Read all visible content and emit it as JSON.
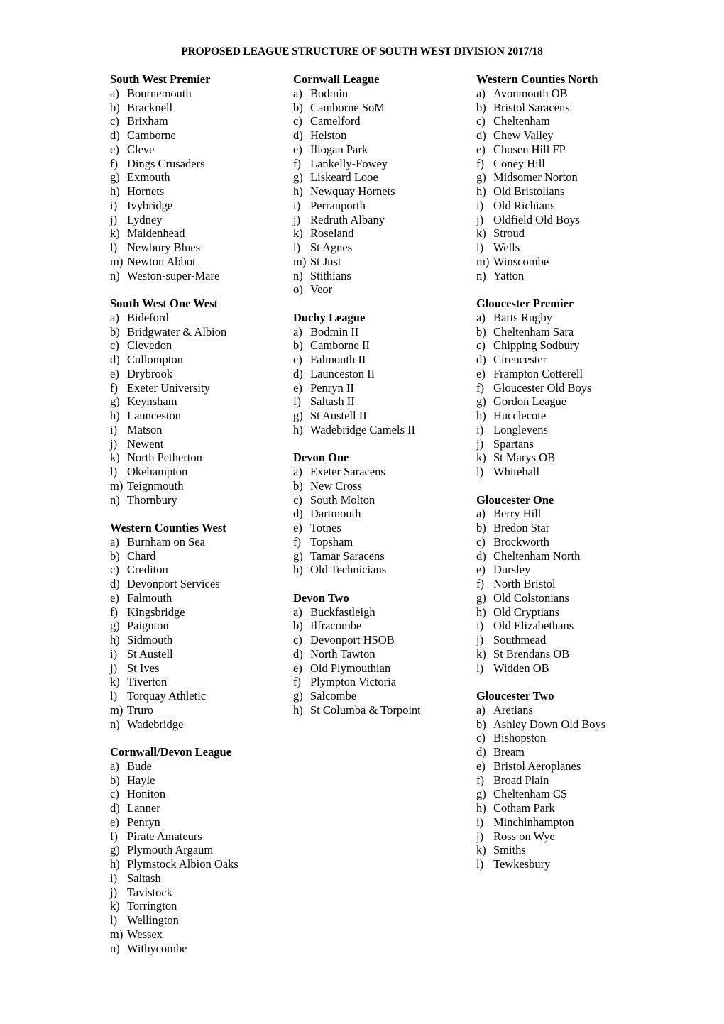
{
  "title": "PROPOSED LEAGUE STRUCTURE OF SOUTH WEST DIVISION 2017/18",
  "columns": [
    {
      "sections": [
        {
          "heading": "South West Premier",
          "teams": [
            {
              "letter": "a)",
              "name": "Bournemouth"
            },
            {
              "letter": "b)",
              "name": "Bracknell"
            },
            {
              "letter": "c)",
              "name": "Brixham"
            },
            {
              "letter": "d)",
              "name": "Camborne"
            },
            {
              "letter": "e)",
              "name": "Cleve"
            },
            {
              "letter": "f)",
              "name": "Dings Crusaders"
            },
            {
              "letter": "g)",
              "name": "Exmouth"
            },
            {
              "letter": "h)",
              "name": "Hornets"
            },
            {
              "letter": "i)",
              "name": "Ivybridge"
            },
            {
              "letter": "j)",
              "name": "Lydney"
            },
            {
              "letter": "k)",
              "name": "Maidenhead"
            },
            {
              "letter": "l)",
              "name": "Newbury Blues"
            },
            {
              "letter": "m)",
              "name": "Newton Abbot"
            },
            {
              "letter": "n)",
              "name": "Weston-super-Mare"
            }
          ]
        },
        {
          "heading": "South West One West",
          "teams": [
            {
              "letter": "a)",
              "name": "Bideford"
            },
            {
              "letter": "b)",
              "name": "Bridgwater & Albion"
            },
            {
              "letter": "c)",
              "name": "Clevedon"
            },
            {
              "letter": "d)",
              "name": "Cullompton"
            },
            {
              "letter": "e)",
              "name": "Drybrook"
            },
            {
              "letter": "f)",
              "name": "Exeter University"
            },
            {
              "letter": "g)",
              "name": "Keynsham"
            },
            {
              "letter": "h)",
              "name": "Launceston"
            },
            {
              "letter": "i)",
              "name": "Matson"
            },
            {
              "letter": "j)",
              "name": "Newent"
            },
            {
              "letter": "k)",
              "name": "North Petherton"
            },
            {
              "letter": "l)",
              "name": "Okehampton"
            },
            {
              "letter": "m)",
              "name": "Teignmouth"
            },
            {
              "letter": "n)",
              "name": "Thornbury"
            }
          ]
        },
        {
          "heading": "Western Counties West",
          "teams": [
            {
              "letter": "a)",
              "name": "Burnham on Sea"
            },
            {
              "letter": "b)",
              "name": "Chard"
            },
            {
              "letter": "c)",
              "name": "Crediton"
            },
            {
              "letter": "d)",
              "name": "Devonport Services"
            },
            {
              "letter": "e)",
              "name": "Falmouth"
            },
            {
              "letter": "f)",
              "name": "Kingsbridge"
            },
            {
              "letter": "g)",
              "name": "Paignton"
            },
            {
              "letter": "h)",
              "name": "Sidmouth"
            },
            {
              "letter": "i)",
              "name": "St Austell"
            },
            {
              "letter": "j)",
              "name": "St Ives"
            },
            {
              "letter": "k)",
              "name": "Tiverton"
            },
            {
              "letter": "l)",
              "name": "Torquay Athletic"
            },
            {
              "letter": "m)",
              "name": "Truro"
            },
            {
              "letter": "n)",
              "name": "Wadebridge"
            }
          ]
        },
        {
          "heading": "Cornwall/Devon League",
          "teams": [
            {
              "letter": "a)",
              "name": "Bude"
            },
            {
              "letter": "b)",
              "name": "Hayle"
            },
            {
              "letter": "c)",
              "name": "Honiton"
            },
            {
              "letter": "d)",
              "name": "Lanner"
            },
            {
              "letter": "e)",
              "name": "Penryn"
            },
            {
              "letter": "f)",
              "name": "Pirate Amateurs"
            },
            {
              "letter": "g)",
              "name": "Plymouth Argaum"
            },
            {
              "letter": "h)",
              "name": "Plymstock Albion Oaks"
            },
            {
              "letter": "i)",
              "name": "Saltash"
            },
            {
              "letter": "j)",
              "name": "Tavistock"
            },
            {
              "letter": "k)",
              "name": "Torrington"
            },
            {
              "letter": "l)",
              "name": "Wellington"
            },
            {
              "letter": "m)",
              "name": "Wessex"
            },
            {
              "letter": "n)",
              "name": "Withycombe"
            }
          ]
        }
      ]
    },
    {
      "sections": [
        {
          "heading": "Cornwall League",
          "teams": [
            {
              "letter": "a)",
              "name": "Bodmin"
            },
            {
              "letter": "b)",
              "name": "Camborne SoM"
            },
            {
              "letter": "c)",
              "name": "Camelford"
            },
            {
              "letter": "d)",
              "name": "Helston"
            },
            {
              "letter": "e)",
              "name": "Illogan Park"
            },
            {
              "letter": "f)",
              "name": "Lankelly-Fowey"
            },
            {
              "letter": "g)",
              "name": "Liskeard Looe"
            },
            {
              "letter": "h)",
              "name": "Newquay Hornets"
            },
            {
              "letter": "i)",
              "name": "Perranporth"
            },
            {
              "letter": "j)",
              "name": "Redruth Albany"
            },
            {
              "letter": "k)",
              "name": "Roseland"
            },
            {
              "letter": "l)",
              "name": "St Agnes"
            },
            {
              "letter": "m)",
              "name": "St Just"
            },
            {
              "letter": "n)",
              "name": "Stithians"
            },
            {
              "letter": "o)",
              "name": "Veor"
            }
          ]
        },
        {
          "heading": "Duchy League",
          "teams": [
            {
              "letter": "a)",
              "name": "Bodmin II"
            },
            {
              "letter": "b)",
              "name": "Camborne II"
            },
            {
              "letter": "c)",
              "name": "Falmouth II"
            },
            {
              "letter": "d)",
              "name": "Launceston II"
            },
            {
              "letter": "e)",
              "name": "Penryn II"
            },
            {
              "letter": "f)",
              "name": "Saltash II"
            },
            {
              "letter": "g)",
              "name": "St Austell II"
            },
            {
              "letter": "h)",
              "name": "Wadebridge Camels II"
            }
          ]
        },
        {
          "heading": "Devon One",
          "teams": [
            {
              "letter": "a)",
              "name": "Exeter Saracens"
            },
            {
              "letter": "b)",
              "name": "New Cross"
            },
            {
              "letter": "c)",
              "name": "South Molton"
            },
            {
              "letter": "d)",
              "name": "Dartmouth"
            },
            {
              "letter": "e)",
              "name": "Totnes"
            },
            {
              "letter": "f)",
              "name": "Topsham"
            },
            {
              "letter": "g)",
              "name": "Tamar Saracens"
            },
            {
              "letter": "h)",
              "name": "Old Technicians"
            }
          ]
        },
        {
          "heading": "Devon Two",
          "teams": [
            {
              "letter": "a)",
              "name": "Buckfastleigh"
            },
            {
              "letter": "b)",
              "name": "Ilfracombe"
            },
            {
              "letter": "c)",
              "name": "Devonport HSOB"
            },
            {
              "letter": "d)",
              "name": "North Tawton"
            },
            {
              "letter": "e)",
              "name": "Old Plymouthian"
            },
            {
              "letter": "f)",
              "name": "Plympton Victoria"
            },
            {
              "letter": "g)",
              "name": "Salcombe"
            },
            {
              "letter": "h)",
              "name": "St Columba & Torpoint"
            }
          ]
        }
      ]
    },
    {
      "sections": [
        {
          "heading": "Western Counties North",
          "teams": [
            {
              "letter": "a)",
              "name": "Avonmouth OB"
            },
            {
              "letter": "b)",
              "name": "Bristol Saracens"
            },
            {
              "letter": "c)",
              "name": "Cheltenham"
            },
            {
              "letter": "d)",
              "name": "Chew Valley"
            },
            {
              "letter": "e)",
              "name": "Chosen Hill FP"
            },
            {
              "letter": "f)",
              "name": "Coney Hill"
            },
            {
              "letter": "g)",
              "name": "Midsomer Norton"
            },
            {
              "letter": "h)",
              "name": "Old Bristolians"
            },
            {
              "letter": "i)",
              "name": "Old Richians"
            },
            {
              "letter": "j)",
              "name": "Oldfield Old Boys"
            },
            {
              "letter": "k)",
              "name": "Stroud"
            },
            {
              "letter": "l)",
              "name": "Wells"
            },
            {
              "letter": "m)",
              "name": "Winscombe"
            },
            {
              "letter": "n)",
              "name": "Yatton"
            }
          ]
        },
        {
          "heading": "Gloucester Premier",
          "teams": [
            {
              "letter": "a)",
              "name": "Barts Rugby"
            },
            {
              "letter": "b)",
              "name": "Cheltenham Sara"
            },
            {
              "letter": "c)",
              "name": "Chipping Sodbury"
            },
            {
              "letter": "d)",
              "name": "Cirencester"
            },
            {
              "letter": "e)",
              "name": "Frampton Cotterell"
            },
            {
              "letter": "f)",
              "name": "Gloucester Old Boys"
            },
            {
              "letter": "g)",
              "name": "Gordon League"
            },
            {
              "letter": "h)",
              "name": "Hucclecote"
            },
            {
              "letter": "i)",
              "name": "Longlevens"
            },
            {
              "letter": "j)",
              "name": "Spartans"
            },
            {
              "letter": "k)",
              "name": "St Marys OB"
            },
            {
              "letter": "l)",
              "name": "Whitehall"
            }
          ]
        },
        {
          "heading": "Gloucester One",
          "teams": [
            {
              "letter": "a)",
              "name": "Berry Hill"
            },
            {
              "letter": "b)",
              "name": "Bredon Star"
            },
            {
              "letter": "c)",
              "name": "Brockworth"
            },
            {
              "letter": "d)",
              "name": "Cheltenham North"
            },
            {
              "letter": "e)",
              "name": "Dursley"
            },
            {
              "letter": "f)",
              "name": "North Bristol"
            },
            {
              "letter": "g)",
              "name": "Old Colstonians"
            },
            {
              "letter": "h)",
              "name": "Old Cryptians"
            },
            {
              "letter": "i)",
              "name": "Old Elizabethans"
            },
            {
              "letter": "j)",
              "name": "Southmead"
            },
            {
              "letter": "k)",
              "name": "St Brendans OB"
            },
            {
              "letter": "l)",
              "name": "Widden OB"
            }
          ]
        },
        {
          "heading": "Gloucester Two",
          "teams": [
            {
              "letter": "a)",
              "name": "Aretians"
            },
            {
              "letter": "b)",
              "name": "Ashley Down Old Boys"
            },
            {
              "letter": "c)",
              "name": "Bishopston"
            },
            {
              "letter": "d)",
              "name": "Bream"
            },
            {
              "letter": "e)",
              "name": "Bristol Aeroplanes"
            },
            {
              "letter": "f)",
              "name": "Broad Plain"
            },
            {
              "letter": "g)",
              "name": "Cheltenham CS"
            },
            {
              "letter": "h)",
              "name": "Cotham Park"
            },
            {
              "letter": "i)",
              "name": "Minchinhampton"
            },
            {
              "letter": "j)",
              "name": "Ross on Wye"
            },
            {
              "letter": "k)",
              "name": "Smiths"
            },
            {
              "letter": "l)",
              "name": "Tewkesbury"
            }
          ]
        }
      ]
    }
  ]
}
